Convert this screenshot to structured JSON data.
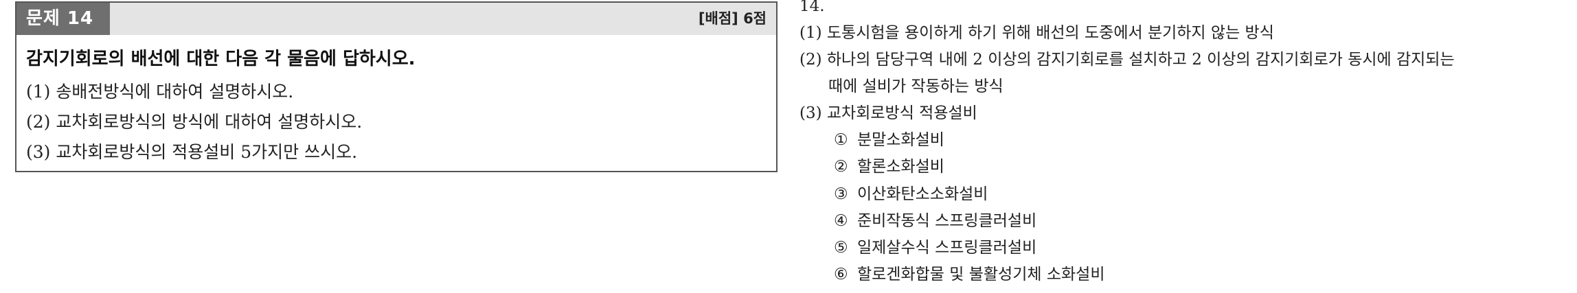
{
  "question": {
    "badge": "문제 14",
    "score": "[배점] 6점",
    "title": "감지기회로의 배선에 대한 다음 각 물음에 답하시오.",
    "items": [
      "(1) 송배전방식에 대하여 설명하시오.",
      "(2) 교차회로방식의 방식에 대하여 설명하시오.",
      "(3) 교차회로방식의 적용설비 5가지만 쓰시오."
    ]
  },
  "answer": {
    "number": "14.",
    "a1": "(1) 도통시험을 용이하게 하기 위해 배선의 도중에서 분기하지 않는 방식",
    "a2": "(2) 하나의 담당구역 내에 2 이상의 감지기회로를 설치하고 2 이상의 감지기회로가 동시에 감지되는",
    "a2_cont": "때에 설비가 작동하는 방식",
    "a3": "(3) 교차회로방식 적용설비",
    "list": [
      {
        "mark": "①",
        "text": "분말소화설비"
      },
      {
        "mark": "②",
        "text": "할론소화설비"
      },
      {
        "mark": "③",
        "text": "이산화탄소소화설비"
      },
      {
        "mark": "④",
        "text": "준비작동식 스프링클러설비"
      },
      {
        "mark": "⑤",
        "text": "일제살수식 스프링클러설비"
      },
      {
        "mark": "⑥",
        "text": "할로겐화합물 및 불활성기체 소화설비"
      }
    ]
  }
}
